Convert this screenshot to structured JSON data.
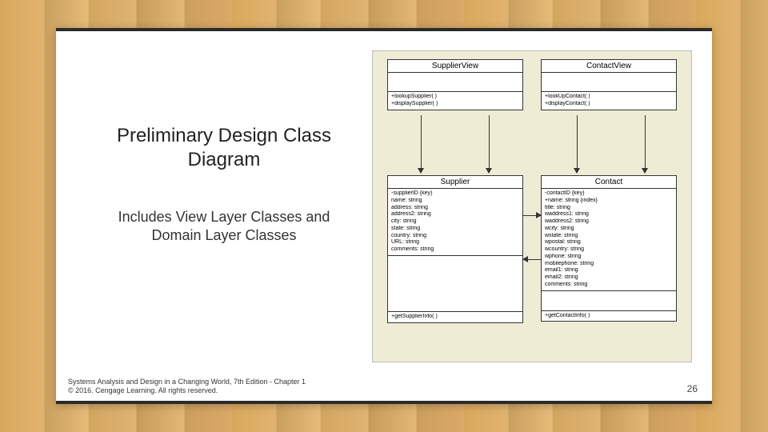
{
  "slide": {
    "title": "Preliminary Design Class Diagram",
    "subtitle": "Includes View Layer Classes and Domain Layer Classes",
    "footer_line1": "Systems Analysis and Design in a Changing World, 7th Edition - Chapter 1",
    "footer_line2": "© 2016. Cengage Learning. All rights reserved.",
    "page_number": "26"
  },
  "classes": {
    "supplier_view": {
      "name": "SupplierView",
      "attrs": [],
      "ops": [
        "+lookupSupplier( )",
        "+displaySupplier( )"
      ]
    },
    "contact_view": {
      "name": "ContactView",
      "attrs": [],
      "ops": [
        "+lookUpContact( )",
        "+displayContact( )"
      ]
    },
    "supplier": {
      "name": "Supplier",
      "attrs": [
        "-supplierID {key}",
        "name: string",
        "address: string",
        "address2: string",
        "city: string",
        "state: string",
        "country: string",
        "URL: string",
        "comments: string"
      ],
      "ops": [
        "+getSupplierInfo( )"
      ]
    },
    "contact": {
      "name": "Contact",
      "attrs": [
        "-contactID {key}",
        "+name: string {index}",
        "title: string",
        "waddress1: string",
        "waddress2: string",
        "wcity: string",
        "wstate: string",
        "wpostal: string",
        "wcountry: string",
        "wphone: string",
        "mobilephone: string",
        "email1: string",
        "email2: string",
        "comments: string"
      ],
      "ops": [
        "+getContactInfo( )"
      ]
    }
  }
}
